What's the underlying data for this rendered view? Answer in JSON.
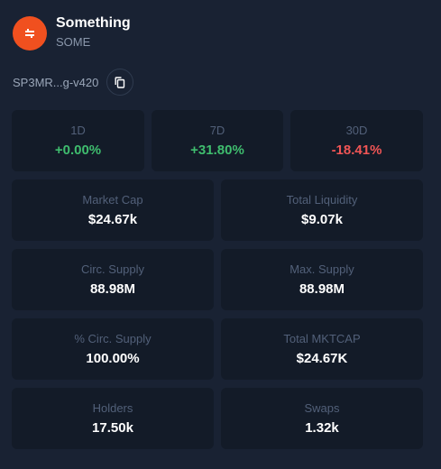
{
  "token": {
    "name": "Something",
    "symbol": "SOME",
    "address": "SP3MR...g-v420",
    "avatar_color": "#f0501f"
  },
  "icons": {
    "avatar": "token-logo-icon",
    "copy": "copy-icon"
  },
  "colors": {
    "positive": "#3fbd6e",
    "negative": "#f05555"
  },
  "price_changes": [
    {
      "label": "1D",
      "value": "+0.00%",
      "trend": "positive"
    },
    {
      "label": "7D",
      "value": "+31.80%",
      "trend": "positive"
    },
    {
      "label": "30D",
      "value": "-18.41%",
      "trend": "negative"
    }
  ],
  "stats": {
    "market_cap": {
      "label": "Market Cap",
      "value": "$24.67k"
    },
    "total_liquidity": {
      "label": "Total Liquidity",
      "value": "$9.07k"
    },
    "circ_supply": {
      "label": "Circ. Supply",
      "value": "88.98M"
    },
    "max_supply": {
      "label": "Max. Supply",
      "value": "88.98M"
    },
    "pct_circ_supply": {
      "label": "% Circ. Supply",
      "value": "100.00%"
    },
    "total_mktcap": {
      "label": "Total MKTCAP",
      "value": "$24.67K"
    },
    "holders": {
      "label": "Holders",
      "value": "17.50k"
    },
    "swaps": {
      "label": "Swaps",
      "value": "1.32k"
    }
  }
}
